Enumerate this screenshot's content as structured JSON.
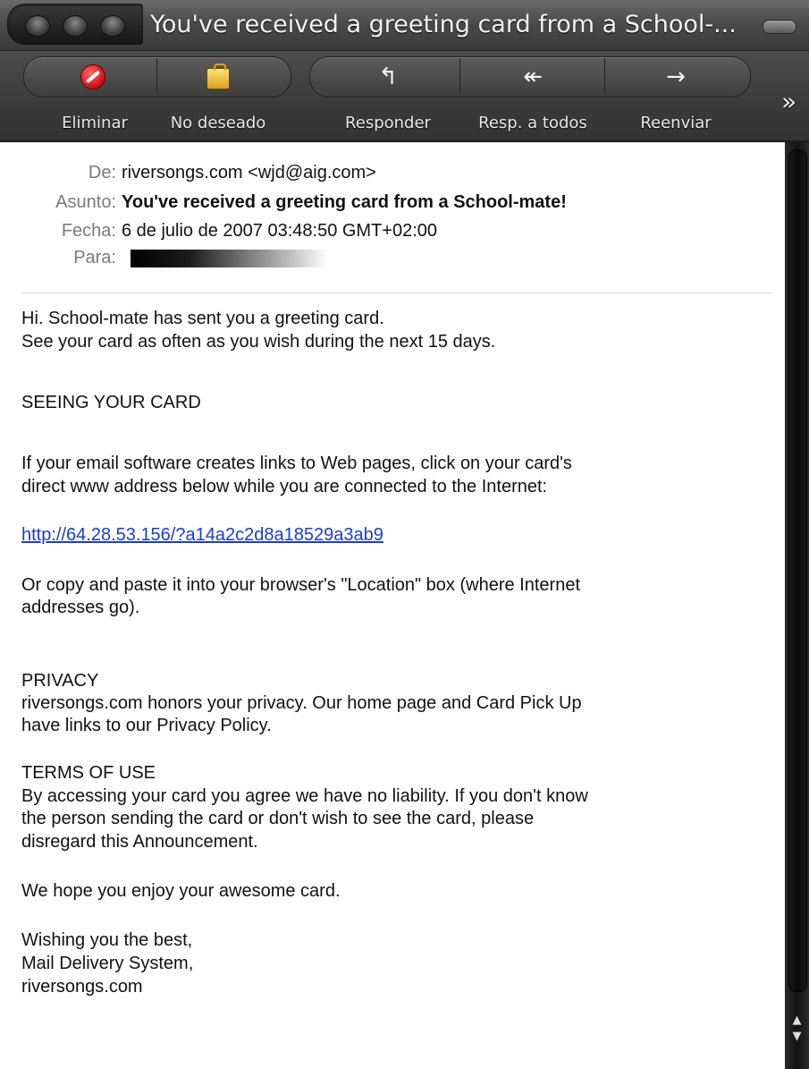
{
  "window": {
    "title": "You've received a greeting card from a School-..."
  },
  "toolbar": {
    "buttons": [
      {
        "label": "Eliminar",
        "icon": "delete-icon"
      },
      {
        "label": "No deseado",
        "icon": "junk-icon"
      },
      {
        "label": "Responder",
        "icon": "reply-icon"
      },
      {
        "label": "Resp. a todos",
        "icon": "reply-all-icon"
      },
      {
        "label": "Reenviar",
        "icon": "forward-icon"
      }
    ],
    "overflow_icon": "overflow-chevron-icon"
  },
  "message": {
    "headers": {
      "from_label": "De:",
      "from": "riversongs.com <wjd@aig.com>",
      "subject_label": "Asunto:",
      "subject": "You've received a greeting card from a School-mate!",
      "date_label": "Fecha:",
      "date": "6 de julio de 2007 03:48:50 GMT+02:00",
      "to_label": "Para:"
    },
    "body": {
      "line1": "Hi. School-mate has sent you a greeting card.",
      "line2": "See your card as often as you wish during the next 15 days.",
      "heading_seeing": "SEEING YOUR CARD",
      "line3": "If your email software creates links to Web pages, click on your card's",
      "line4": "direct www address below while you are connected to the Internet:",
      "link": "http://64.28.53.156/?a14a2c2d8a18529a3ab9",
      "line5": "Or copy and paste it into your browser's \"Location\" box (where Internet",
      "line6": "addresses go).",
      "heading_privacy": "PRIVACY",
      "line7": "riversongs.com honors your privacy. Our home page and Card Pick Up",
      "line8": "have links to our Privacy Policy.",
      "heading_terms": "TERMS OF USE",
      "line9": "By accessing your card you agree we have no liability. If you don't know",
      "line10": "the person sending the card or don't wish to see the card, please",
      "line11": "disregard this Announcement.",
      "line12": "We hope you enjoy your awesome card.",
      "line13": "Wishing you the best,",
      "line14": "Mail Delivery System,",
      "line15": "riversongs.com"
    }
  },
  "colors": {
    "link": "#1a3cd4",
    "toolbar": "#3a3a3a",
    "header_label": "#7a7a7a"
  }
}
